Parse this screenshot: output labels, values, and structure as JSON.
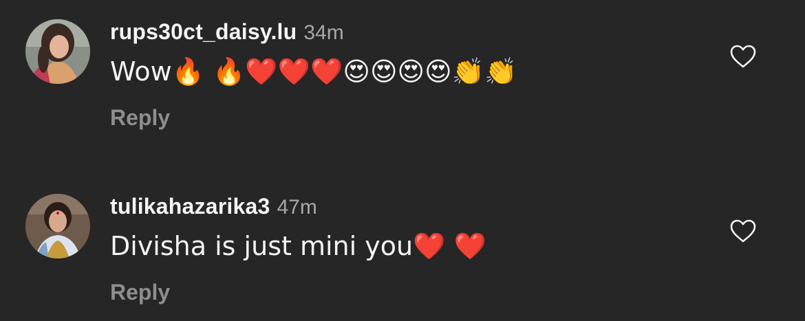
{
  "comments": [
    {
      "username": "rups30ct_daisy.lu",
      "time": "34m",
      "text": "Wow🔥 🔥❤️❤️❤️😍😍😍😍👏👏",
      "reply_label": "Reply",
      "avatar_icon": "user-avatar-woman"
    },
    {
      "username": "tulikahazarika3",
      "time": "47m",
      "text": "Divisha is just mini you❤️ ❤️",
      "reply_label": "Reply",
      "avatar_icon": "user-avatar-woman"
    }
  ],
  "colors": {
    "background": "#262626",
    "username": "#f5f5f5",
    "timestamp": "#a8a8a8",
    "reply": "#8e8e8e",
    "like_icon": "#f5f5f5"
  }
}
